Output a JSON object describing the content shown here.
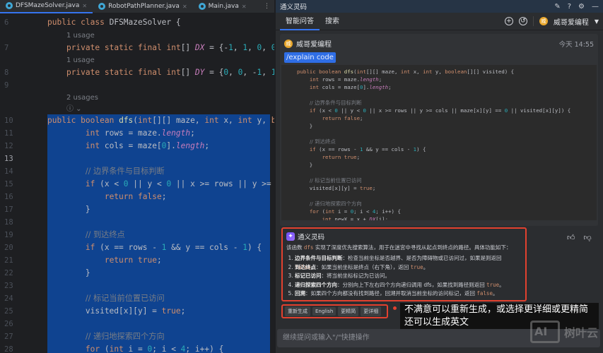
{
  "editor": {
    "tabs": [
      {
        "label": "DFSMazeSolver.java",
        "active": true
      },
      {
        "label": "RobotPathPlanner.java"
      },
      {
        "label": "Main.java"
      }
    ],
    "lines": [
      {
        "n": "6",
        "text": "public class DFSMazeSolver {"
      },
      {
        "hint": "1 usage"
      },
      {
        "n": "7",
        "text": "    private static final int[] DX = {-1, 1, 0, 0};"
      },
      {
        "hint": "1 usage"
      },
      {
        "n": "8",
        "text": "    private static final int[] DY = {0, 0, -1, 1};"
      },
      {
        "n": "9",
        "text": ""
      },
      {
        "hint": "2 usages"
      },
      {
        "hint": "ⓘ ⌄"
      },
      {
        "n": "10",
        "text": "public boolean dfs(int[][] maze, int x, int y, boolean[][] visited) {",
        "sel": true
      },
      {
        "n": "11",
        "text": "        int rows = maze.length;",
        "sel": true
      },
      {
        "n": "12",
        "text": "        int cols = maze[0].length;",
        "sel": true
      },
      {
        "n": "13",
        "text": "",
        "sel": true
      },
      {
        "n": "14",
        "text": "        // 边界条件与目标判断",
        "sel": true
      },
      {
        "n": "15",
        "text": "        if (x < 0 || y < 0 || x >= rows || y >= cols || maze[x][y] == 0 || visited[x][y]) {",
        "sel": true
      },
      {
        "n": "16",
        "text": "            return false;",
        "sel": true
      },
      {
        "n": "17",
        "text": "        }",
        "sel": true
      },
      {
        "n": "18",
        "text": "",
        "sel": true
      },
      {
        "n": "19",
        "text": "        // 到达终点",
        "sel": true
      },
      {
        "n": "20",
        "text": "        if (x == rows - 1 && y == cols - 1) {",
        "sel": true
      },
      {
        "n": "21",
        "text": "            return true;",
        "sel": true
      },
      {
        "n": "22",
        "text": "        }",
        "sel": true
      },
      {
        "n": "23",
        "text": "",
        "sel": true
      },
      {
        "n": "24",
        "text": "        // 标记当前位置已访问",
        "sel": true
      },
      {
        "n": "25",
        "text": "        visited[x][y] = true;",
        "sel": true
      },
      {
        "n": "26",
        "text": "",
        "sel": true
      },
      {
        "n": "27",
        "text": "        // 递归地探索四个方向",
        "sel": true
      },
      {
        "n": "28",
        "text": "        for (int i = 0; i < 4; i++) {",
        "sel": true
      }
    ]
  },
  "panel": {
    "title": "通义灵码",
    "tabs": [
      "智能问答",
      "搜索"
    ],
    "user": "威哥爱编程",
    "message": {
      "user": "威哥爱编程",
      "time": "今天 14:55",
      "command": "/explain code",
      "code": [
        "public boolean dfs(int[][] maze, int x, int y, boolean[][] visited) {",
        "    int rows = maze.length;",
        "    int cols = maze[0].length;",
        "",
        "    // 边界条件与目标判断",
        "    if (x < 0 || y < 0 || x >= rows || y >= cols || maze[x][y] == 0 || visited[x][y]) {",
        "        return false;",
        "    }",
        "",
        "    // 到达终点",
        "    if (x == rows - 1 && y == cols - 1) {",
        "        return true;",
        "    }",
        "",
        "    // 标记当前位置已访问",
        "    visited[x][y] = true;",
        "",
        "    // 递归地探索四个方向",
        "    for (int i = 0; i < 4; i++) {",
        "        int newX = x + DX[i];"
      ]
    },
    "answer": {
      "name": "通义灵码",
      "intro_a": "该函数 ",
      "intro_code": "dfs",
      "intro_b": " 实现了深度优先搜索算法，用于在迷宫中寻找从起点到终点的路径。具体功能如下：",
      "items": [
        {
          "title": "边界条件与目标判断",
          "text": "：检查当前坐标是否越界、是否为障碍物或已访问过，如果是则返回 ",
          "code": "false",
          "end": "。"
        },
        {
          "title": "到达终点",
          "text": "：如果当前坐标是终点（右下角），返回 ",
          "code": "true",
          "end": "。"
        },
        {
          "title": "标记已访问",
          "text": "：将当前坐标标记为已访问。",
          "code": "",
          "end": ""
        },
        {
          "title": "递归探索四个方向",
          "text": "：分别向上下左右四个方向递归调用 dfs，如果找到路径则返回 ",
          "code": "true",
          "end": "。"
        },
        {
          "title": "回溯",
          "text": "：如果四个方向都没有找到路径，回溯并取消当前坐标的访问标记，返回 ",
          "code": "false",
          "end": "。"
        }
      ]
    },
    "actions": [
      "重新生成",
      "English",
      "更精简",
      "更详细"
    ],
    "tooltip": "不满意可以重新生成，或选择更详细或更精简还可以生成英文",
    "input_placeholder": "继续提问或输入\"/\"快捷操作",
    "watermark": "AI 树叶云"
  },
  "colors": {
    "accent": "#3574f0",
    "highlight_border": "#e2412f",
    "selection": "#0f4390"
  }
}
